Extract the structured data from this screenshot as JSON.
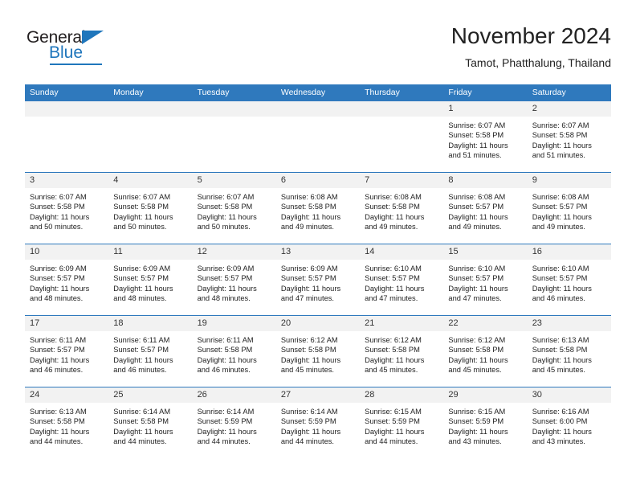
{
  "brand": {
    "name_part1": "General",
    "name_part2": "Blue",
    "accent_color": "#1f76bc"
  },
  "header": {
    "title": "November 2024",
    "subtitle": "Tamot, Phatthalung, Thailand"
  },
  "calendar": {
    "header_bg": "#2f79bd",
    "weekdays": [
      "Sunday",
      "Monday",
      "Tuesday",
      "Wednesday",
      "Thursday",
      "Friday",
      "Saturday"
    ],
    "weeks": [
      [
        {
          "day": "",
          "empty": true
        },
        {
          "day": "",
          "empty": true
        },
        {
          "day": "",
          "empty": true
        },
        {
          "day": "",
          "empty": true
        },
        {
          "day": "",
          "empty": true
        },
        {
          "day": "1",
          "sunrise": "Sunrise: 6:07 AM",
          "sunset": "Sunset: 5:58 PM",
          "daylight1": "Daylight: 11 hours",
          "daylight2": "and 51 minutes."
        },
        {
          "day": "2",
          "sunrise": "Sunrise: 6:07 AM",
          "sunset": "Sunset: 5:58 PM",
          "daylight1": "Daylight: 11 hours",
          "daylight2": "and 51 minutes."
        }
      ],
      [
        {
          "day": "3",
          "sunrise": "Sunrise: 6:07 AM",
          "sunset": "Sunset: 5:58 PM",
          "daylight1": "Daylight: 11 hours",
          "daylight2": "and 50 minutes."
        },
        {
          "day": "4",
          "sunrise": "Sunrise: 6:07 AM",
          "sunset": "Sunset: 5:58 PM",
          "daylight1": "Daylight: 11 hours",
          "daylight2": "and 50 minutes."
        },
        {
          "day": "5",
          "sunrise": "Sunrise: 6:07 AM",
          "sunset": "Sunset: 5:58 PM",
          "daylight1": "Daylight: 11 hours",
          "daylight2": "and 50 minutes."
        },
        {
          "day": "6",
          "sunrise": "Sunrise: 6:08 AM",
          "sunset": "Sunset: 5:58 PM",
          "daylight1": "Daylight: 11 hours",
          "daylight2": "and 49 minutes."
        },
        {
          "day": "7",
          "sunrise": "Sunrise: 6:08 AM",
          "sunset": "Sunset: 5:58 PM",
          "daylight1": "Daylight: 11 hours",
          "daylight2": "and 49 minutes."
        },
        {
          "day": "8",
          "sunrise": "Sunrise: 6:08 AM",
          "sunset": "Sunset: 5:57 PM",
          "daylight1": "Daylight: 11 hours",
          "daylight2": "and 49 minutes."
        },
        {
          "day": "9",
          "sunrise": "Sunrise: 6:08 AM",
          "sunset": "Sunset: 5:57 PM",
          "daylight1": "Daylight: 11 hours",
          "daylight2": "and 49 minutes."
        }
      ],
      [
        {
          "day": "10",
          "sunrise": "Sunrise: 6:09 AM",
          "sunset": "Sunset: 5:57 PM",
          "daylight1": "Daylight: 11 hours",
          "daylight2": "and 48 minutes."
        },
        {
          "day": "11",
          "sunrise": "Sunrise: 6:09 AM",
          "sunset": "Sunset: 5:57 PM",
          "daylight1": "Daylight: 11 hours",
          "daylight2": "and 48 minutes."
        },
        {
          "day": "12",
          "sunrise": "Sunrise: 6:09 AM",
          "sunset": "Sunset: 5:57 PM",
          "daylight1": "Daylight: 11 hours",
          "daylight2": "and 48 minutes."
        },
        {
          "day": "13",
          "sunrise": "Sunrise: 6:09 AM",
          "sunset": "Sunset: 5:57 PM",
          "daylight1": "Daylight: 11 hours",
          "daylight2": "and 47 minutes."
        },
        {
          "day": "14",
          "sunrise": "Sunrise: 6:10 AM",
          "sunset": "Sunset: 5:57 PM",
          "daylight1": "Daylight: 11 hours",
          "daylight2": "and 47 minutes."
        },
        {
          "day": "15",
          "sunrise": "Sunrise: 6:10 AM",
          "sunset": "Sunset: 5:57 PM",
          "daylight1": "Daylight: 11 hours",
          "daylight2": "and 47 minutes."
        },
        {
          "day": "16",
          "sunrise": "Sunrise: 6:10 AM",
          "sunset": "Sunset: 5:57 PM",
          "daylight1": "Daylight: 11 hours",
          "daylight2": "and 46 minutes."
        }
      ],
      [
        {
          "day": "17",
          "sunrise": "Sunrise: 6:11 AM",
          "sunset": "Sunset: 5:57 PM",
          "daylight1": "Daylight: 11 hours",
          "daylight2": "and 46 minutes."
        },
        {
          "day": "18",
          "sunrise": "Sunrise: 6:11 AM",
          "sunset": "Sunset: 5:57 PM",
          "daylight1": "Daylight: 11 hours",
          "daylight2": "and 46 minutes."
        },
        {
          "day": "19",
          "sunrise": "Sunrise: 6:11 AM",
          "sunset": "Sunset: 5:58 PM",
          "daylight1": "Daylight: 11 hours",
          "daylight2": "and 46 minutes."
        },
        {
          "day": "20",
          "sunrise": "Sunrise: 6:12 AM",
          "sunset": "Sunset: 5:58 PM",
          "daylight1": "Daylight: 11 hours",
          "daylight2": "and 45 minutes."
        },
        {
          "day": "21",
          "sunrise": "Sunrise: 6:12 AM",
          "sunset": "Sunset: 5:58 PM",
          "daylight1": "Daylight: 11 hours",
          "daylight2": "and 45 minutes."
        },
        {
          "day": "22",
          "sunrise": "Sunrise: 6:12 AM",
          "sunset": "Sunset: 5:58 PM",
          "daylight1": "Daylight: 11 hours",
          "daylight2": "and 45 minutes."
        },
        {
          "day": "23",
          "sunrise": "Sunrise: 6:13 AM",
          "sunset": "Sunset: 5:58 PM",
          "daylight1": "Daylight: 11 hours",
          "daylight2": "and 45 minutes."
        }
      ],
      [
        {
          "day": "24",
          "sunrise": "Sunrise: 6:13 AM",
          "sunset": "Sunset: 5:58 PM",
          "daylight1": "Daylight: 11 hours",
          "daylight2": "and 44 minutes."
        },
        {
          "day": "25",
          "sunrise": "Sunrise: 6:14 AM",
          "sunset": "Sunset: 5:58 PM",
          "daylight1": "Daylight: 11 hours",
          "daylight2": "and 44 minutes."
        },
        {
          "day": "26",
          "sunrise": "Sunrise: 6:14 AM",
          "sunset": "Sunset: 5:59 PM",
          "daylight1": "Daylight: 11 hours",
          "daylight2": "and 44 minutes."
        },
        {
          "day": "27",
          "sunrise": "Sunrise: 6:14 AM",
          "sunset": "Sunset: 5:59 PM",
          "daylight1": "Daylight: 11 hours",
          "daylight2": "and 44 minutes."
        },
        {
          "day": "28",
          "sunrise": "Sunrise: 6:15 AM",
          "sunset": "Sunset: 5:59 PM",
          "daylight1": "Daylight: 11 hours",
          "daylight2": "and 44 minutes."
        },
        {
          "day": "29",
          "sunrise": "Sunrise: 6:15 AM",
          "sunset": "Sunset: 5:59 PM",
          "daylight1": "Daylight: 11 hours",
          "daylight2": "and 43 minutes."
        },
        {
          "day": "30",
          "sunrise": "Sunrise: 6:16 AM",
          "sunset": "Sunset: 6:00 PM",
          "daylight1": "Daylight: 11 hours",
          "daylight2": "and 43 minutes."
        }
      ]
    ]
  }
}
